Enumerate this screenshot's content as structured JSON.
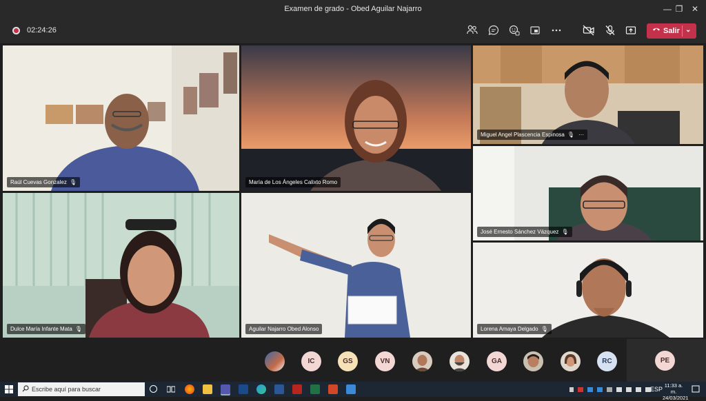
{
  "window": {
    "title": "Examen de grado - Obed Aguilar Najarro",
    "minimize": "—",
    "maximize": "❐",
    "close": "✕"
  },
  "callbar": {
    "timer": "02:24:26",
    "leave_label": "Salir",
    "icons": [
      "participants-icon",
      "chat-icon",
      "reactions-icon",
      "share-tray-icon",
      "more-icon",
      "camera-off-icon",
      "mic-off-icon",
      "share-screen-icon"
    ]
  },
  "participants": [
    {
      "name": "Raúl Cuevas Gonzalez"
    },
    {
      "name": "María de Los Ángeles Calixto Romo"
    },
    {
      "name": "Miguel Angel Plascencia Espinosa"
    },
    {
      "name": "José Ernesto Sánchez Vázquez"
    },
    {
      "name": "Dulce María Infante Mata"
    },
    {
      "name": "Aguilar Najarro Obed Alonso"
    },
    {
      "name": "Lorena Amaya Delgado"
    }
  ],
  "more_menu": "···",
  "avatars": [
    {
      "initials": "",
      "color": "#7a5a48"
    },
    {
      "initials": "IC",
      "color": "#f2d7d5"
    },
    {
      "initials": "GS",
      "color": "#f7e2b8"
    },
    {
      "initials": "VN",
      "color": "#f2d7d5"
    },
    {
      "initials": "",
      "color": "#8a6a5a"
    },
    {
      "initials": "",
      "color": "#6a5a50"
    },
    {
      "initials": "GA",
      "color": "#f2d7d5"
    },
    {
      "initials": "",
      "color": "#8a7060"
    },
    {
      "initials": "",
      "color": "#a08070"
    },
    {
      "initials": "RC",
      "color": "#d6e2f2"
    },
    {
      "initials": "PE",
      "color": "#f2d7d5"
    }
  ],
  "taskbar": {
    "search_placeholder": "Escribe aquí para buscar",
    "language": "ESP",
    "time": "11:33 a. m.",
    "date": "24/03/2021"
  }
}
